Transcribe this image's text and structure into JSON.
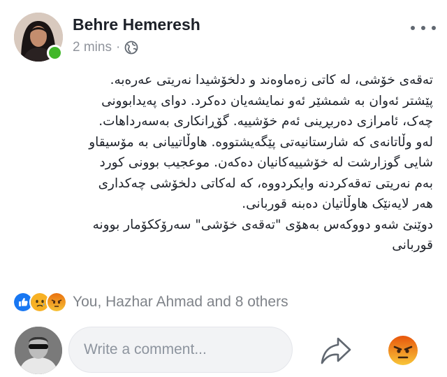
{
  "post": {
    "author_name": "Behre Hemeresh",
    "timestamp": "2 mins",
    "separator": "·",
    "privacy_icon": "globe-icon",
    "paragraphs": [
      "تەقەی خۆشی، لە کاتی زەماوەند و دلخۆشیدا نەریتی عەرەبە.",
      "پێشتر ئەوان بە شمشێر ئەو نمایشەیان دەکرد. دوای پەیدابوونی",
      "چەک، ئامرازی دەربڕینی ئەم خۆشییە. گۆڕانکاری بەسەرداهات.",
      "لەو وڵاتانەی کە شارستانیەتی پێگەیشتووە. هاوڵاتییانی بە مۆسیقاو",
      "شایی گوزارشت لە خۆشییەکانیان دەکەن. موعجیب بوونی کورد",
      "بەم نەریتی تەقەکردنە وایکردووە، کە لەکاتی دلخۆشی چەکداری",
      "هەر لایەنێک هاوڵاتیان دەبنە قوربانی.",
      "دوێنێ شەو دووکەس بەهۆی \"تەقەی خۆشی\" سەرۆککۆمار بوونە",
      "قوربانی"
    ]
  },
  "reactions": {
    "icons": [
      "like-icon",
      "sad-icon",
      "angry-icon"
    ],
    "summary": "You, Hazhar Ahmad and 8 others"
  },
  "comment": {
    "placeholder": "Write a comment..."
  },
  "colors": {
    "online": "#42b72a",
    "like_blue": "#1877f2",
    "reaction_yellow": "#f7b125",
    "angry_orange": "#e9710f",
    "muted_text": "#90949c"
  }
}
